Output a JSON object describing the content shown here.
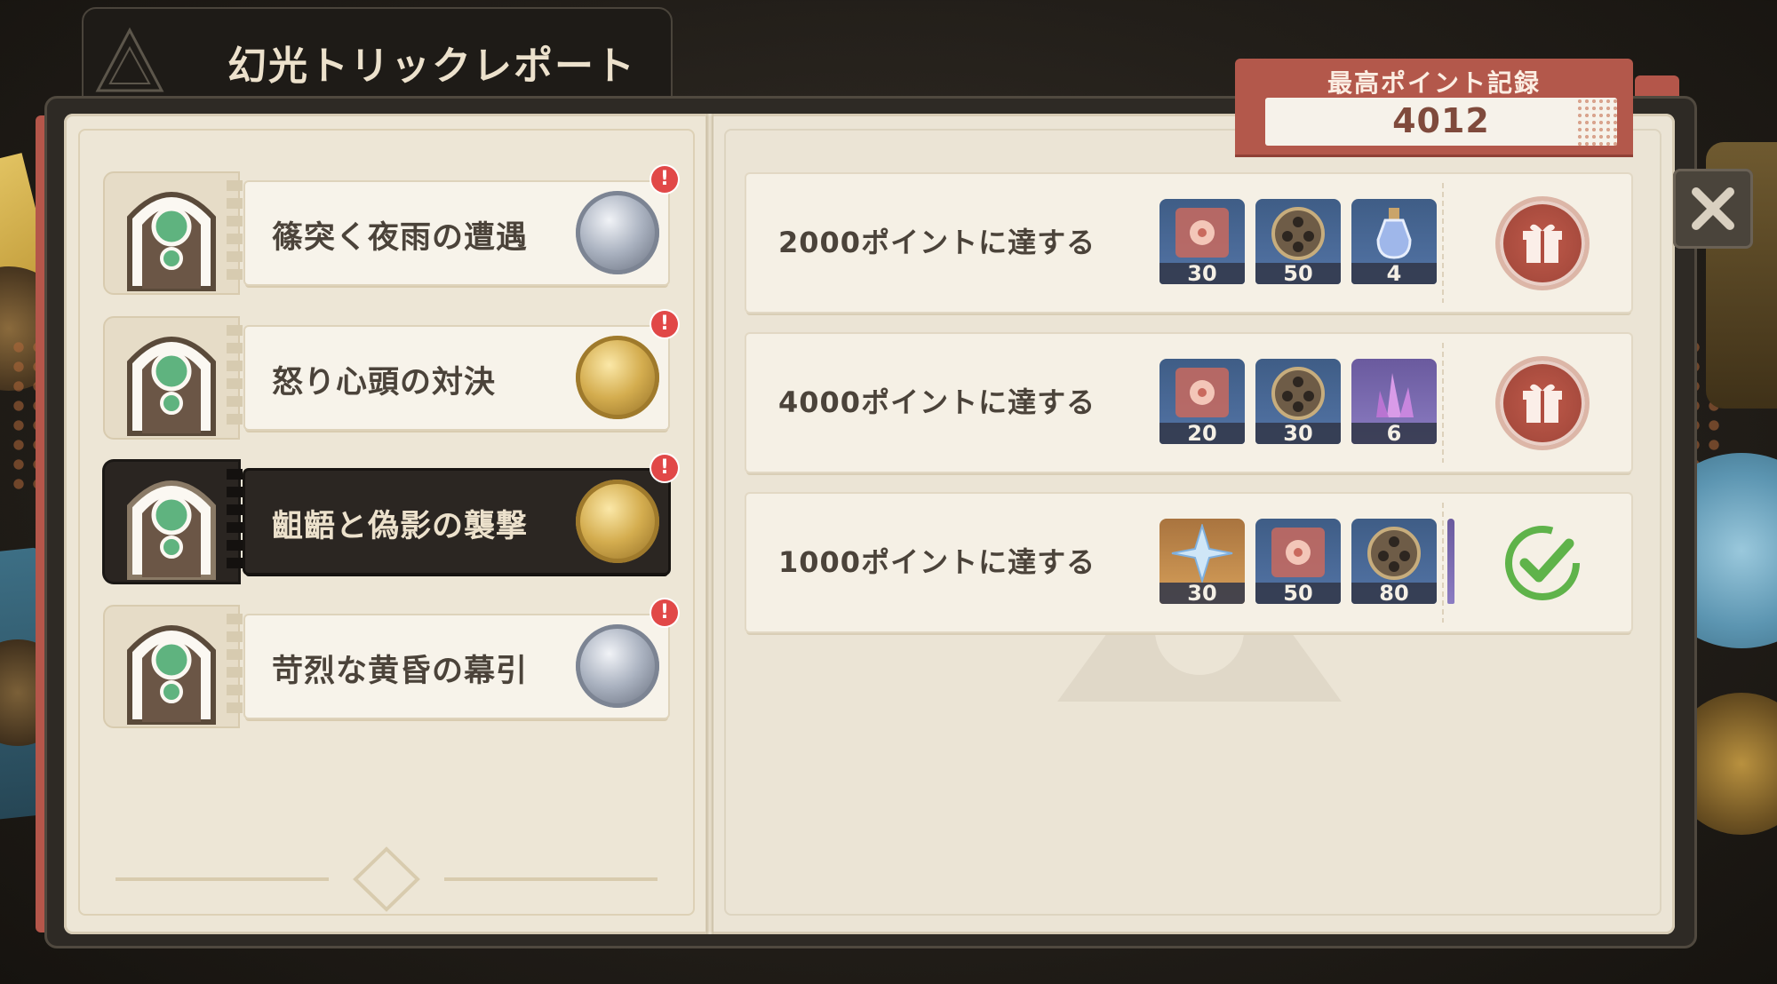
{
  "title": "幻光トリックレポート",
  "best_record": {
    "label": "最高ポイント記録",
    "value": "4012"
  },
  "stages": [
    {
      "name": "篠突く夜雨の遭遇",
      "medal": "silver",
      "alert": "!"
    },
    {
      "name": "怒り心頭の対決",
      "medal": "gold",
      "alert": "!"
    },
    {
      "name": "齟齬と偽影の襲撃",
      "medal": "gold",
      "alert": "!",
      "selected": true
    },
    {
      "name": "苛烈な黄昏の幕引",
      "medal": "silver",
      "alert": "!"
    }
  ],
  "rewards": [
    {
      "requirement": "2000ポイントに達する",
      "status": "claimable",
      "items": [
        {
          "icon": "flower-badge-icon",
          "qty": "30",
          "bg": "blue"
        },
        {
          "icon": "film-reel-icon",
          "qty": "50",
          "bg": "blue"
        },
        {
          "icon": "potion-bottle-icon",
          "qty": "4",
          "bg": "blue"
        }
      ]
    },
    {
      "requirement": "4000ポイントに達する",
      "status": "claimable",
      "items": [
        {
          "icon": "flower-badge-icon",
          "qty": "20",
          "bg": "blue"
        },
        {
          "icon": "film-reel-icon",
          "qty": "30",
          "bg": "blue"
        },
        {
          "icon": "crystal-cluster-icon",
          "qty": "6",
          "bg": "purple"
        }
      ]
    },
    {
      "requirement": "1000ポイントに達する",
      "status": "claimed",
      "items": [
        {
          "icon": "primogem-icon",
          "qty": "30",
          "bg": "orange"
        },
        {
          "icon": "flower-badge-icon",
          "qty": "50",
          "bg": "blue"
        },
        {
          "icon": "film-reel-icon",
          "qty": "80",
          "bg": "blue"
        }
      ]
    }
  ],
  "colors": {
    "accent_red": "#b3584b",
    "alert_red": "#e14848",
    "check_green": "#5fb34a",
    "panel_bg": "#ebe4d5",
    "selected_bg": "#2b2622"
  }
}
